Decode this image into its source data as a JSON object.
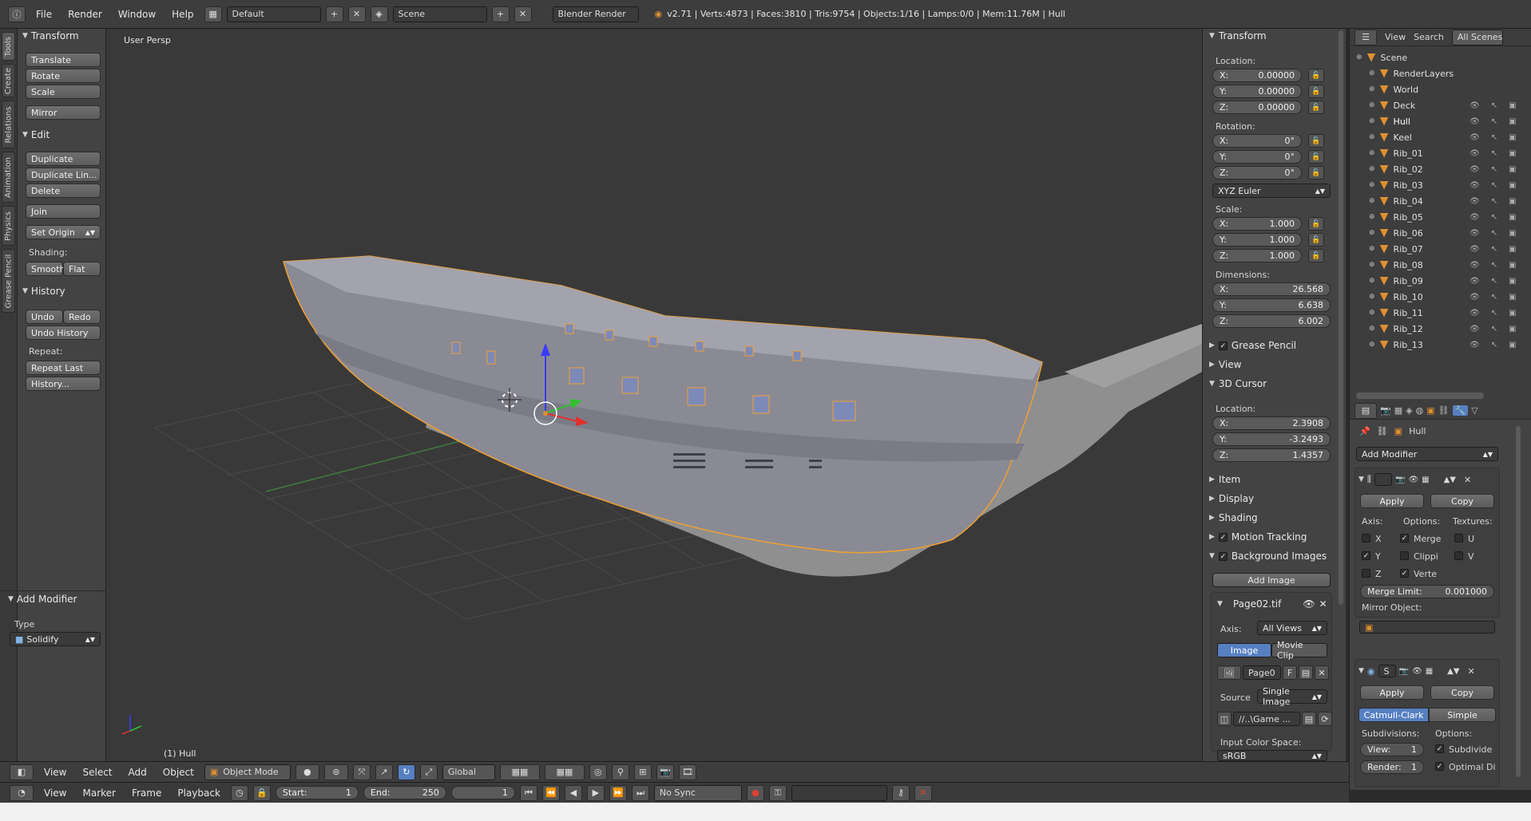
{
  "topbar": {
    "menus": [
      "File",
      "Render",
      "Window",
      "Help"
    ],
    "layout_value": "Default",
    "scene_value": "Scene",
    "engine_value": "Blender Render",
    "stats": "v2.71 | Verts:4873 | Faces:3810 | Tris:9754 | Objects:1/16 | Lamps:0/0 | Mem:11.76M | Hull"
  },
  "left_tabs": [
    "Tools",
    "Create",
    "Relations",
    "Animation",
    "Physics",
    "Grease Pencil"
  ],
  "tools": {
    "transform_header": "Transform",
    "translate": "Translate",
    "rotate": "Rotate",
    "scale": "Scale",
    "mirror": "Mirror",
    "edit_header": "Edit",
    "duplicate": "Duplicate",
    "duplicate_linked": "Duplicate Lin...",
    "delete": "Delete",
    "join": "Join",
    "set_origin": "Set Origin",
    "shading_label": "Shading:",
    "smooth": "Smooth",
    "flat": "Flat",
    "history_header": "History",
    "undo": "Undo",
    "redo": "Redo",
    "undo_history": "Undo History",
    "repeat_label": "Repeat:",
    "repeat_last": "Repeat Last",
    "history_btn": "History..."
  },
  "operator": {
    "header": "Add Modifier",
    "type_label": "Type",
    "type_value": "Solidify"
  },
  "viewport": {
    "view_label": "User Persp",
    "object_label": "(1) Hull"
  },
  "properties": {
    "transform_header": "Transform",
    "location_label": "Location:",
    "loc_x": "0.00000",
    "loc_y": "0.00000",
    "loc_z": "0.00000",
    "rotation_label": "Rotation:",
    "rot_x": "0°",
    "rot_y": "0°",
    "rot_z": "0°",
    "rotation_mode": "XYZ Euler",
    "scale_label": "Scale:",
    "scale_x": "1.000",
    "scale_y": "1.000",
    "scale_z": "1.000",
    "dimensions_label": "Dimensions:",
    "dim_x": "26.568",
    "dim_y": "6.638",
    "dim_z": "6.002",
    "grease_pencil": "Grease Pencil",
    "view": "View",
    "cursor_header": "3D Cursor",
    "cursor_location_label": "Location:",
    "cur_x": "2.3908",
    "cur_y": "-3.2493",
    "cur_z": "1.4357",
    "item": "Item",
    "display": "Display",
    "shading": "Shading",
    "motion_tracking": "Motion Tracking",
    "background_images": "Background Images",
    "add_image": "Add Image",
    "image_name": "Page02.tif",
    "axis_label": "Axis:",
    "axis_value": "All Views",
    "image_tab": "Image",
    "movie_clip_tab": "Movie Clip",
    "image_block": "Page0",
    "image_f": "F",
    "source_label": "Source",
    "source_value": "Single Image",
    "filepath": "//..\\Game ...",
    "color_space_label": "Input Color Space:",
    "color_space_value": "sRGB"
  },
  "outliner": {
    "view": "View",
    "search": "Search",
    "scenes": "All Scenes",
    "rows": [
      {
        "label": "Scene",
        "indent": 0
      },
      {
        "label": "RenderLayers",
        "indent": 1
      },
      {
        "label": "World",
        "indent": 1
      },
      {
        "label": "Deck",
        "indent": 1
      },
      {
        "label": "Hull",
        "indent": 1
      },
      {
        "label": "Keel",
        "indent": 1
      },
      {
        "label": "Rib_01",
        "indent": 1
      },
      {
        "label": "Rib_02",
        "indent": 1
      },
      {
        "label": "Rib_03",
        "indent": 1
      },
      {
        "label": "Rib_04",
        "indent": 1
      },
      {
        "label": "Rib_05",
        "indent": 1
      },
      {
        "label": "Rib_06",
        "indent": 1
      },
      {
        "label": "Rib_07",
        "indent": 1
      },
      {
        "label": "Rib_08",
        "indent": 1
      },
      {
        "label": "Rib_09",
        "indent": 1
      },
      {
        "label": "Rib_10",
        "indent": 1
      },
      {
        "label": "Rib_11",
        "indent": 1
      },
      {
        "label": "Rib_12",
        "indent": 1
      },
      {
        "label": "Rib_13",
        "indent": 1
      }
    ]
  },
  "modifiers": {
    "breadcrumb_object": "Hull",
    "add_modifier": "Add Modifier",
    "apply": "Apply",
    "copy": "Copy",
    "axis_label": "Axis:",
    "options_label": "Options:",
    "textures_label": "Textures:",
    "x": "X",
    "y": "Y",
    "z": "Z",
    "merge": "Merge",
    "clipping": "Clippi",
    "vertex": "Verte",
    "u": "U",
    "v": "V",
    "merge_limit_label": "Merge Limit:",
    "merge_limit_value": "0.001000",
    "mirror_object_label": "Mirror Object:",
    "subsurf_name": "S",
    "catmull_clark": "Catmull-Clark",
    "simple": "Simple",
    "subdivisions_label": "Subdivisions:",
    "sub_options_label": "Options:",
    "view_label": "View:",
    "view_value": "1",
    "render_label": "Render:",
    "render_value": "1",
    "subdivide_uvs": "Subdivide",
    "optimal_display": "Optimal Di"
  },
  "header3d": {
    "view": "View",
    "select": "Select",
    "add": "Add",
    "object": "Object",
    "mode": "Object Mode",
    "orientation": "Global"
  },
  "timeline": {
    "view": "View",
    "marker": "Marker",
    "frame": "Frame",
    "playback": "Playback",
    "start_label": "Start:",
    "start_value": "1",
    "end_label": "End:",
    "end_value": "250",
    "current_frame": "1",
    "sync": "No Sync"
  },
  "colors": {
    "accent": "#5680c2",
    "selection_outline": "#f0a030",
    "hull_body": "#8a8a95"
  }
}
